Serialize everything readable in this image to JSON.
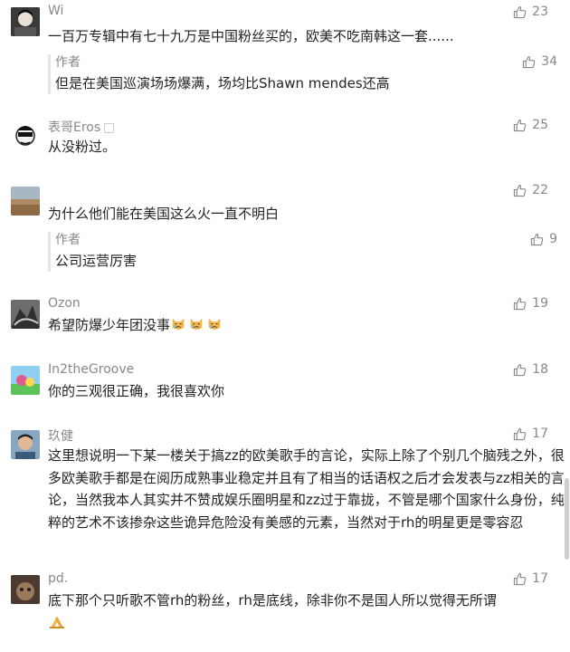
{
  "comments": [
    {
      "username": "Wi",
      "likes": "23",
      "text": "一百万专辑中有七十九万是中国粉丝买的，欧美不吃南韩这一套......",
      "reply": {
        "username": "作者",
        "likes": "34",
        "text": "但是在美国巡演场场爆满，场均比Shawn mendes还高"
      }
    },
    {
      "username": "表哥Eros",
      "likes": "25",
      "text": "从没粉过。"
    },
    {
      "username": "",
      "likes": "22",
      "text": "为什么他们能在美国这么火一直不明白",
      "reply": {
        "username": "作者",
        "likes": "9",
        "text": "公司运营厉害"
      }
    },
    {
      "username": "Ozon",
      "likes": "19",
      "text": "希望防爆少年团没事"
    },
    {
      "username": "In2theGroove",
      "likes": "18",
      "text": "你的三观很正确，我很喜欢你"
    },
    {
      "username": "玖健",
      "likes": "17",
      "text": "这里想说明一下某一楼关于搞zz的欧美歌手的言论，实际上除了个别几个脑残之外，很多欧美歌手都是在阅历成熟事业稳定并且有了相当的话语权之后才会发表与zz相关的言论，当然我本人其实并不赞成娱乐圈明星和zz过于靠拢，不管是哪个国家什么身份，纯粹的艺术不该掺杂这些诡异危险没有美感的元素，当然对于rh的明星更是零容忍"
    },
    {
      "username": "pd.",
      "likes": "17",
      "text": "底下那个只听歌不管rh的粉丝，rh是底线，除非你不是国人所以觉得无所谓"
    }
  ],
  "colors": {
    "meta": "#888888",
    "text": "#222222",
    "divider": "#e6e6e6"
  }
}
